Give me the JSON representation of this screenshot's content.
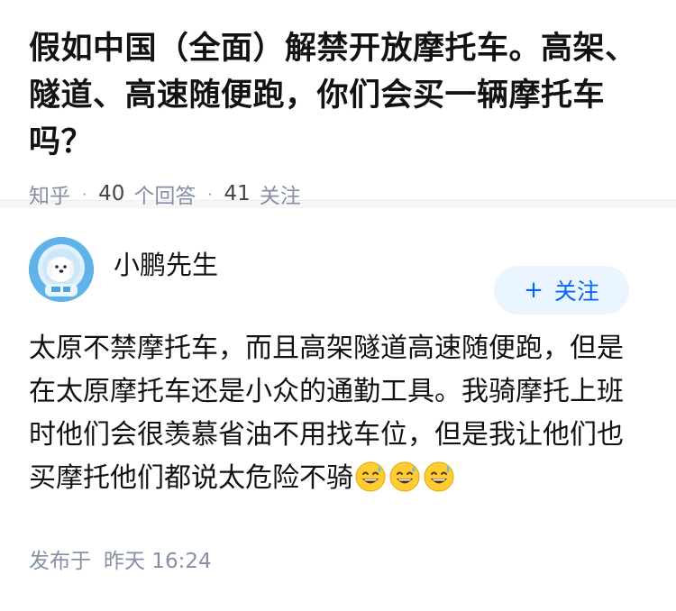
{
  "question": {
    "title": "假如中国（全面）解禁开放摩托车。高架、隧道、高速随便跑，你们会买一辆摩托车吗？",
    "source": "知乎",
    "answer_count": "40",
    "answer_label": "个回答",
    "follower_count": "41",
    "follower_label": "关注"
  },
  "answer": {
    "author_name": "小鹏先生",
    "follow_button": "关注",
    "follow_plus": "+",
    "content": "太原不禁摩托车，而且高架隧道高速随便跑，但是在太原摩托车还是小众的通勤工具。我骑摩托上班时他们会很羡慕省油不用找车位，但是我让他们也买摩托他们都说太危险不骑",
    "emojis": [
      "sweat-smile-icon",
      "sweat-smile-icon",
      "sweat-smile-icon"
    ],
    "published_label": "发布于",
    "published_time": "昨天 16:24"
  },
  "colors": {
    "accent": "#0066ff",
    "follow_bg": "#ebf5ff",
    "meta_gray": "#8590a6",
    "avatar_blue": "#4aa3df"
  }
}
